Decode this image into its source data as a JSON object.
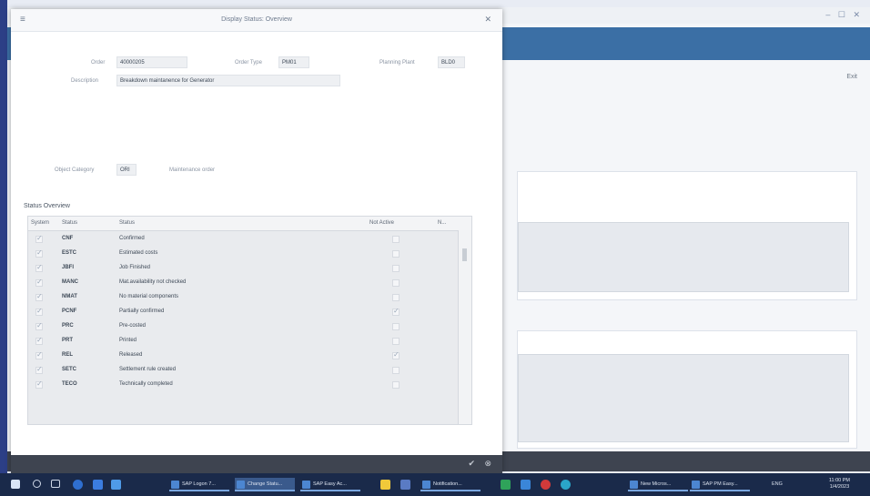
{
  "background_window": {
    "exit_label": "Exit",
    "window_controls": "– ☐ ✕"
  },
  "dialog": {
    "title": "Display Status: Overview",
    "fields": {
      "order_label": "Order",
      "order_value": "40000205",
      "order_type_label": "Order Type",
      "order_type_value": "PM01",
      "planning_plant_label": "Planning Plant",
      "planning_plant_value": "BLD0",
      "description_label": "Description",
      "description_value": "Breakdown maintanence for Generator",
      "object_category_label": "Object Category",
      "object_category_value": "ORI",
      "object_category_text": "Maintenance order"
    },
    "status_overview": {
      "title": "Status Overview",
      "columns": [
        "System",
        "Status",
        "Status",
        "Not Active",
        "N..."
      ],
      "rows": [
        {
          "system": true,
          "code": "CNF",
          "text": "Confirmed",
          "not_active": false
        },
        {
          "system": true,
          "code": "ESTC",
          "text": "Estimated costs",
          "not_active": false
        },
        {
          "system": true,
          "code": "JBFI",
          "text": "Job Finished",
          "not_active": false
        },
        {
          "system": true,
          "code": "MANC",
          "text": "Mat.availability not checked",
          "not_active": false
        },
        {
          "system": true,
          "code": "NMAT",
          "text": "No material components",
          "not_active": false
        },
        {
          "system": true,
          "code": "PCNF",
          "text": "Partially confirmed",
          "not_active": true
        },
        {
          "system": true,
          "code": "PRC",
          "text": "Pre-costed",
          "not_active": false
        },
        {
          "system": true,
          "code": "PRT",
          "text": "Printed",
          "not_active": false
        },
        {
          "system": true,
          "code": "REL",
          "text": "Released",
          "not_active": true
        },
        {
          "system": true,
          "code": "SETC",
          "text": "Settlement rule created",
          "not_active": false
        },
        {
          "system": true,
          "code": "TECO",
          "text": "Technically completed",
          "not_active": false
        }
      ]
    },
    "footer": {
      "ok_icon": "check-icon",
      "cancel_icon": "cancel-icon"
    }
  },
  "taskbar": {
    "apps": [
      {
        "label": "SAP Logon 7..."
      },
      {
        "label": "Change Statu..."
      },
      {
        "label": "SAP Easy Ac..."
      },
      {
        "label": "Notification..."
      },
      {
        "label": "New Micros..."
      },
      {
        "label": "SAP PM Easy..."
      }
    ],
    "language": "ENG",
    "time": "11:00 PM",
    "date": "1/4/2023"
  },
  "colors": {
    "header_blue": "#3b6fa5",
    "footer_dark": "#3e4450",
    "taskbar": "#1a2a4a"
  }
}
